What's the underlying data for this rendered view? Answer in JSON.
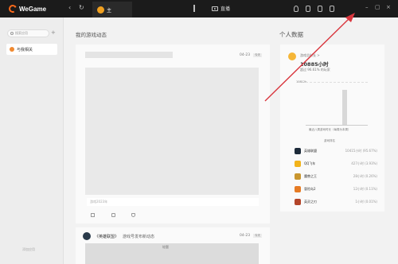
{
  "titlebar": {
    "app": "WeGame",
    "tab_label": "主",
    "live_label": "直播",
    "back": "‹",
    "refresh": "↻",
    "minimize": "–",
    "restore": "▢",
    "close": "×"
  },
  "sidebar": {
    "search_placeholder": "搜索应用",
    "add": "+",
    "item_label": "与我相关",
    "footer": "添加应用"
  },
  "feed": {
    "title": "我的游戏动态",
    "card1": {
      "time": "04-23",
      "tag": "今天",
      "caption": "游戏2023年",
      "actions": [
        "share",
        "comment",
        "like"
      ]
    },
    "card2": {
      "author": "《英雄联盟》",
      "desc": "游戏号发布新动态",
      "time": "04-23",
      "tag": "今天",
      "banner": "轮题"
    }
  },
  "stats": {
    "title": "个人数据",
    "label": "游戏总时长 >",
    "hours": "10885小时",
    "sub": "超过 96.61% 的玩家",
    "y_top": "10812h",
    "x_label": "最近八周游戏时长（每周为本周）",
    "list_title": "游戏排名",
    "games": [
      {
        "name": "英雄联盟",
        "time": "10415小时 (95.67%)",
        "color": "#1d2b3a"
      },
      {
        "name": "QQ飞车",
        "time": "427小时 (3.93%)",
        "color": "#f2b31a"
      },
      {
        "name": "魔兽之王",
        "time": "28小时 (0.26%)",
        "color": "#c9962e"
      },
      {
        "name": "冒险岛2",
        "time": "12小时 (0.11%)",
        "color": "#e67b24"
      },
      {
        "name": "英灵之刃",
        "time": "1小时 (0.01%)",
        "color": "#b3452a"
      }
    ],
    "bar_colors": {
      "main": "#d8d8d8"
    }
  },
  "annotation": {
    "arrow_color": "#d9363e"
  }
}
